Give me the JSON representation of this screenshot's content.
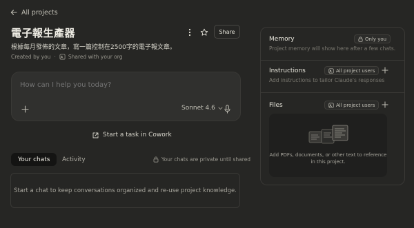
{
  "nav": {
    "back_label": "All projects"
  },
  "project": {
    "title": "電子報生產器",
    "description": "根據每月發佈的文章，寫一篇控制在2500字的電子報文章。",
    "created_by": "Created by you",
    "separator": "·",
    "shared": "Shared with your org"
  },
  "header": {
    "share_label": "Share"
  },
  "composer": {
    "placeholder": "How can I help you today?",
    "model": "Sonnet 4.6"
  },
  "cowork": {
    "label": "Start a task in Cowork"
  },
  "tabs": [
    {
      "label": "Your chats",
      "active": true
    },
    {
      "label": "Activity",
      "active": false
    }
  ],
  "privacy_note": "Your chats are private until shared",
  "empty_state": "Start a chat to keep conversations organized and re-use project knowledge.",
  "sidebar": {
    "memory": {
      "title": "Memory",
      "badge": "Only you",
      "subtitle": "Project memory will show here after a few chats."
    },
    "instructions": {
      "title": "Instructions",
      "badge": "All project users",
      "subtitle": "Add instructions to tailor Claude's responses"
    },
    "files": {
      "title": "Files",
      "badge": "All project users",
      "drop_text": "Add PDFs, documents, or other text to reference in this project."
    }
  },
  "colors": {
    "background": "#262624",
    "panel_border": "#3a3936",
    "composer_bg": "#30302e",
    "tab_active_bg": "#141413"
  },
  "icons": [
    "arrow-left-icon",
    "more-vertical-icon",
    "star-icon",
    "plus-icon",
    "chevron-down-icon",
    "mic-icon",
    "external-link-icon",
    "lock-icon",
    "users-icon",
    "document-stack-icon"
  ]
}
